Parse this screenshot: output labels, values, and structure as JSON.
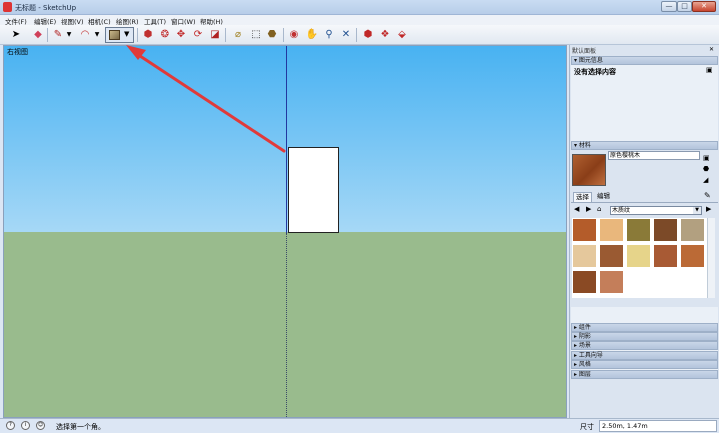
{
  "window": {
    "title": "无标题 - SketchUp",
    "min": "—",
    "max": "□",
    "close": "✕"
  },
  "menu": [
    "文件(F)",
    "编辑(E)",
    "视图(V)",
    "相机(C)",
    "绘图(R)",
    "工具(T)",
    "窗口(W)",
    "帮助(H)"
  ],
  "toolbar": {
    "icons": [
      "select-icon",
      "eraser-icon",
      "pencil-icon",
      "arc-icon",
      "rectangle-icon",
      "push-pull-icon",
      "follow-me-icon",
      "move-icon",
      "rotate-icon",
      "scale-icon",
      "tape-measure-icon",
      "text-icon",
      "paint-bucket-icon",
      "orbit-icon",
      "pan-icon",
      "zoom-icon",
      "zoom-extents-icon",
      "warehouse-icon",
      "extension-icon",
      "share-icon"
    ],
    "accent": "#dfe8f5"
  },
  "viewport": {
    "view_label": "右视图",
    "sky_color": "#5fbdf3",
    "ground_color": "#99bb8d"
  },
  "panel": {
    "tray_title": "默认面板",
    "entity_info": {
      "header": "图元信息",
      "no_selection": "没有选择内容"
    },
    "materials": {
      "header": "材料",
      "name": "原色樱桃木",
      "tab_select": "选择",
      "tab_edit": "编辑",
      "library": "木质纹",
      "swatches": [
        "#b45c2a",
        "#e9b77c",
        "#8a7a38",
        "#7c4a28",
        "#b2a080",
        "#e5c89c",
        "#9a5a32",
        "#e6d48a",
        "#a85a34",
        "#bb6a36",
        "#8a4a24",
        "#c47e5a"
      ]
    },
    "collapsed": [
      "组件",
      "阴影",
      "场景",
      "工具向导",
      "风格",
      "图层"
    ]
  },
  "status": {
    "text": "选择第一个角。",
    "measure_label": "尺寸",
    "measure_value": "2.50m, 1.47m"
  }
}
